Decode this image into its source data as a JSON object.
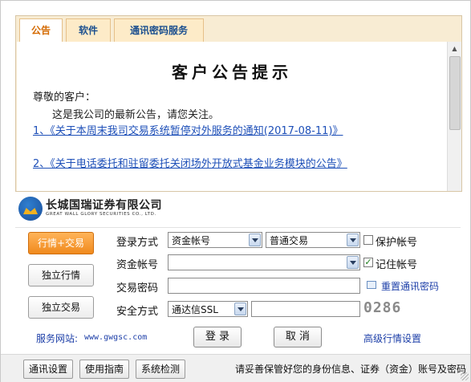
{
  "tabs": [
    {
      "label": "公告",
      "active": true
    },
    {
      "label": "软件",
      "active": false
    },
    {
      "label": "通讯密码服务",
      "active": false
    }
  ],
  "notice": {
    "title": "客户公告提示",
    "greeting": "尊敬的客户：",
    "intro": "这是我公司的最新公告，请您关注。",
    "links": [
      "1、《关于本周末我司交易系统暂停对外服务的通知(2017-08-11)》",
      "2、《关于电话委托和驻留委托关闭场外开放式基金业务模块的公告》"
    ]
  },
  "logo": {
    "name_cn": "长城国瑞证券有限公司",
    "name_en": "GREAT WALL GLORY SECURITIES CO., LTD."
  },
  "side_buttons": [
    {
      "label": "行情+交易",
      "active": true
    },
    {
      "label": "独立行情",
      "active": false
    },
    {
      "label": "独立交易",
      "active": false
    }
  ],
  "form": {
    "login_method_label": "登录方式",
    "login_method_value": "资金帐号",
    "trade_type_value": "普通交易",
    "protect_account_label": "保护帐号",
    "protect_account_checked": false,
    "account_label": "资金帐号",
    "account_value": "",
    "remember_account_label": "记住帐号",
    "remember_account_checked": true,
    "password_label": "交易密码",
    "password_value": "",
    "reset_comm_password_label": "重置通讯密码",
    "security_label": "安全方式",
    "security_value": "通达信SSL",
    "security_input_value": "",
    "captcha": "0286",
    "login_button": "登 录",
    "cancel_button": "取 消",
    "advanced_settings": "高级行情设置"
  },
  "service_site": {
    "label": "服务网站:",
    "url": "www.gwgsc.com"
  },
  "bottom": {
    "buttons": [
      "通讯设置",
      "使用指南",
      "系统检测"
    ],
    "tip": "请妥善保管好您的身份信息、证券（资金）账号及密码"
  },
  "colors": {
    "accent_orange": "#f08a1d",
    "link_blue": "#1d4fb8",
    "tab_text_blue": "#1b4f8f"
  }
}
